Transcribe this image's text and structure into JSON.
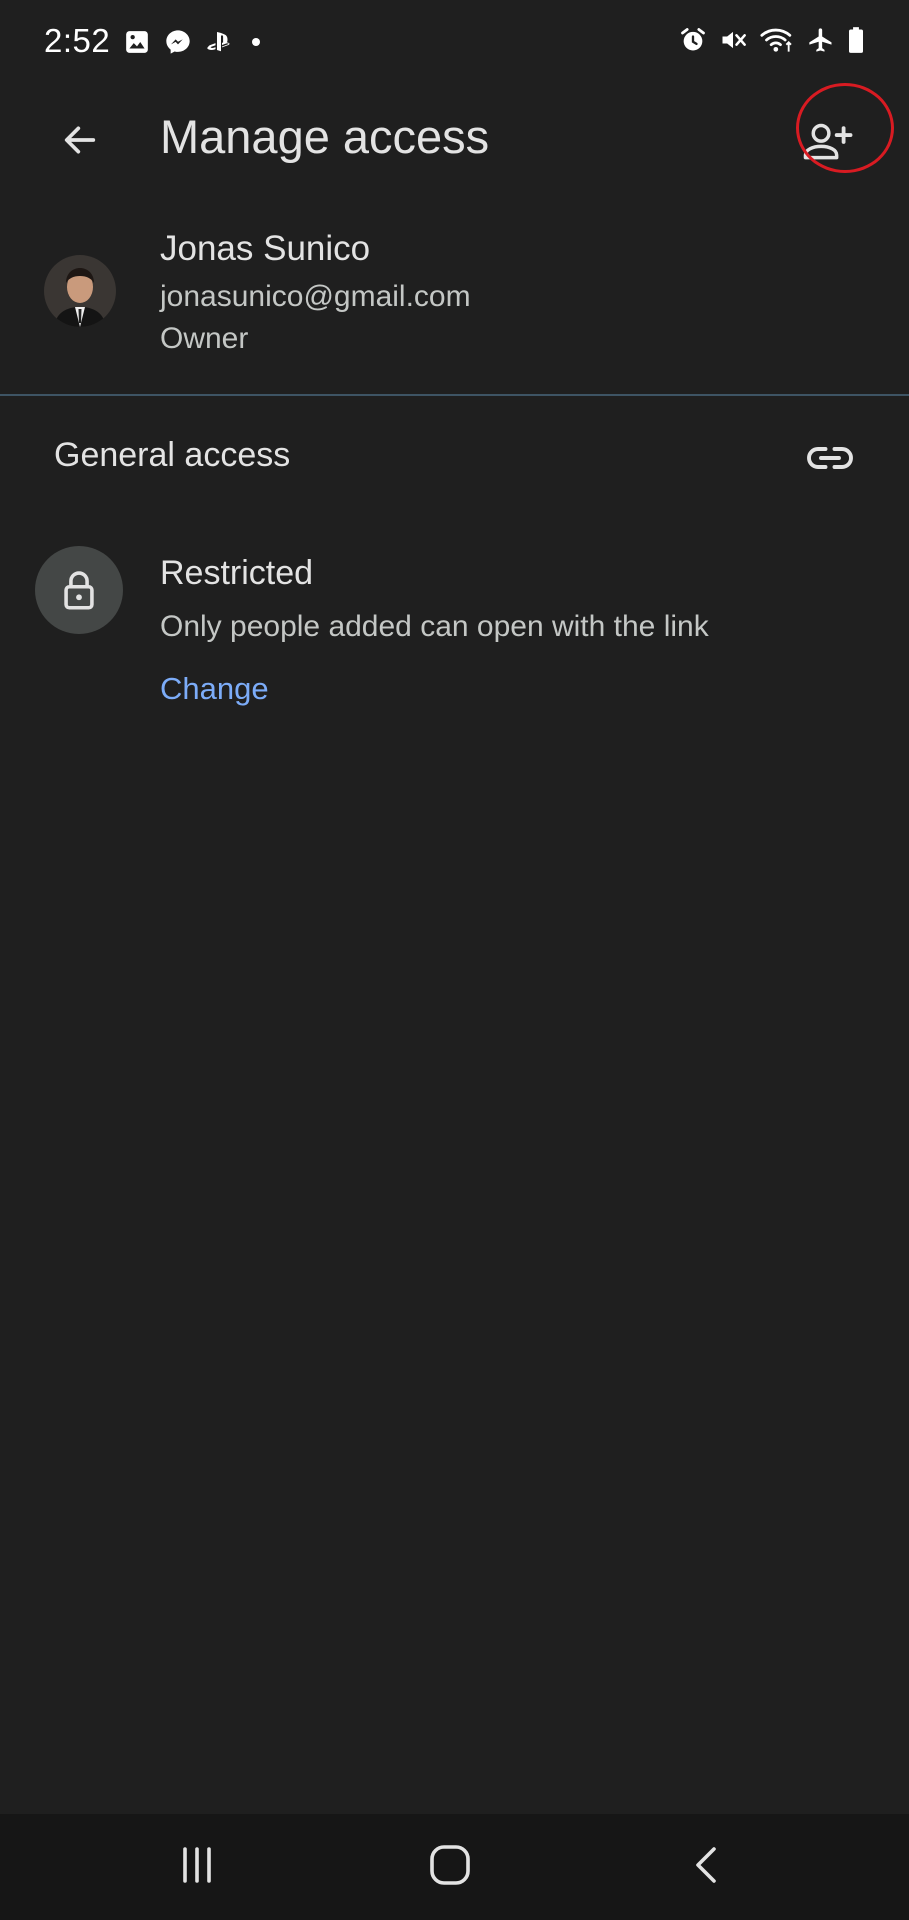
{
  "status_bar": {
    "time": "2:52",
    "left_icons": [
      "gallery-icon",
      "messenger-icon",
      "playstation-icon",
      "dot-icon"
    ],
    "right_icons": [
      "alarm-icon",
      "mute-icon",
      "wifi-icon",
      "airplane-icon",
      "battery-icon"
    ]
  },
  "app_bar": {
    "title": "Manage access",
    "back_icon": "arrow-back-icon",
    "add_people_icon": "person-add-icon",
    "highlight_color": "#d81b22"
  },
  "owner": {
    "name": "Jonas Sunico",
    "email": "jonasunico@gmail.com",
    "role": "Owner"
  },
  "general_access": {
    "header": "General access",
    "link_icon": "link-icon",
    "level": "Restricted",
    "description": "Only people added can open with the link",
    "change_label": "Change",
    "link_color": "#7cacf8"
  },
  "nav_bar": {
    "buttons": [
      "recents-icon",
      "home-icon",
      "back-icon"
    ]
  }
}
